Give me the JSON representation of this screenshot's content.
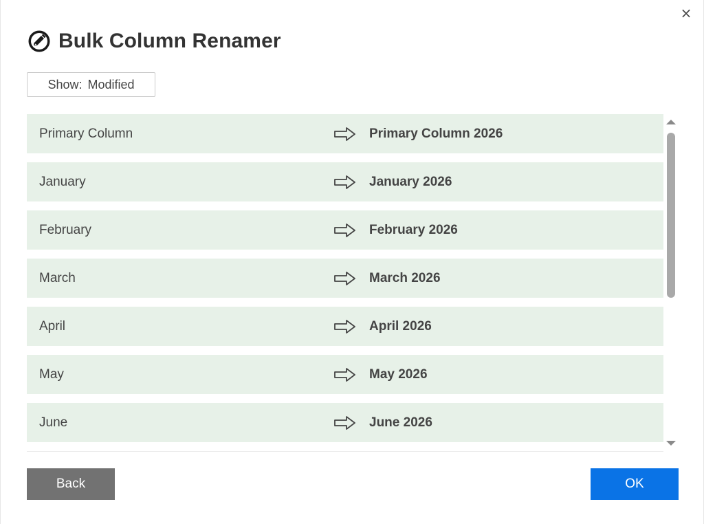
{
  "dialog": {
    "title": "Bulk Column Renamer",
    "close_label": "×"
  },
  "filter": {
    "label": "Show:",
    "value": "Modified"
  },
  "rows": [
    {
      "original": "Primary Column",
      "renamed": "Primary Column 2026"
    },
    {
      "original": "January",
      "renamed": "January 2026"
    },
    {
      "original": "February",
      "renamed": "February 2026"
    },
    {
      "original": "March",
      "renamed": "March 2026"
    },
    {
      "original": "April",
      "renamed": "April 2026"
    },
    {
      "original": "May",
      "renamed": "May 2026"
    },
    {
      "original": "June",
      "renamed": "June 2026"
    }
  ],
  "footer": {
    "back_label": "Back",
    "ok_label": "OK"
  },
  "colors": {
    "row_background": "#e7f1e8",
    "ok_button": "#0a73e6",
    "back_button": "#727272"
  },
  "icons": {
    "app": "pencil-circle-icon",
    "row_arrow": "right-arrow-icon",
    "close": "close-icon"
  }
}
